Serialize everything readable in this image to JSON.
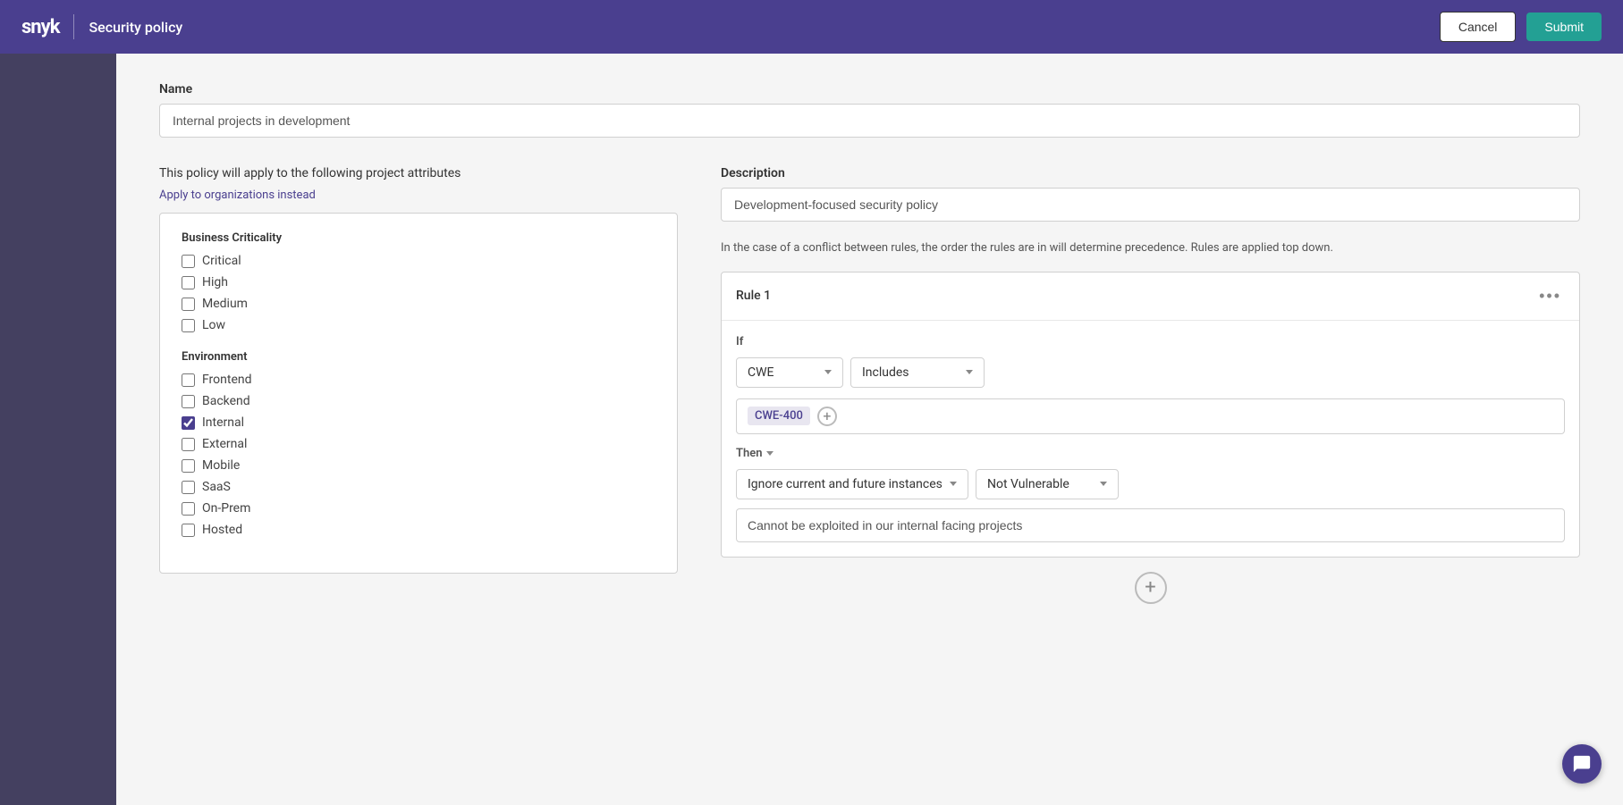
{
  "header": {
    "logo": "snyk",
    "title": "Security policy",
    "cancel_label": "Cancel",
    "submit_label": "Submit"
  },
  "form": {
    "name_label": "Name",
    "name_value": "Internal projects in development",
    "policy_scope_text": "This policy will apply to the following project attributes",
    "apply_link_text": "Apply to organizations instead",
    "business_criticality_label": "Business Criticality",
    "checkboxes_criticality": [
      {
        "label": "Critical",
        "checked": false
      },
      {
        "label": "High",
        "checked": false
      },
      {
        "label": "Medium",
        "checked": false
      },
      {
        "label": "Low",
        "checked": false
      }
    ],
    "environment_label": "Environment",
    "checkboxes_environment": [
      {
        "label": "Frontend",
        "checked": false
      },
      {
        "label": "Backend",
        "checked": false
      },
      {
        "label": "Internal",
        "checked": true
      },
      {
        "label": "External",
        "checked": false
      },
      {
        "label": "Mobile",
        "checked": false
      },
      {
        "label": "SaaS",
        "checked": false
      },
      {
        "label": "On-Prem",
        "checked": false
      },
      {
        "label": "Hosted",
        "checked": false
      }
    ],
    "description_label": "Description",
    "description_value": "Development-focused security policy",
    "conflict_note": "In the case of a conflict between rules, the order the rules are in will determine precedence. Rules are applied top down.",
    "rule": {
      "title": "Rule 1",
      "if_label": "If",
      "condition_field1": "CWE",
      "condition_field2": "Includes",
      "cwe_tag": "CWE-400",
      "then_label": "Then",
      "action_field1": "Ignore current and future instances",
      "action_field2": "Not Vulnerable",
      "reason_placeholder": "Cannot be exploited in our internal facing projects"
    }
  }
}
